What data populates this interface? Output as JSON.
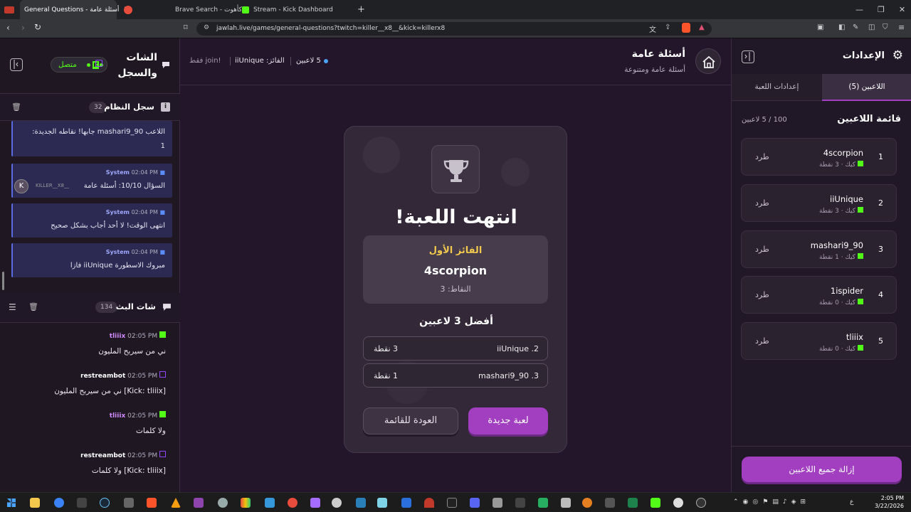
{
  "browser": {
    "tabs": [
      {
        "label": "General Questions - أسئلة عامة",
        "active": true
      },
      {
        "label": "",
        "active": false
      },
      {
        "label": "Brave Search - كأهوت",
        "active": false
      },
      {
        "label": "Stream - Kick Dashboard",
        "active": false
      }
    ],
    "url": "jawlah.live/games/general-questions?twitch=killer__x8__&kick=killerx8"
  },
  "left": {
    "title_line1": "الشات",
    "title_line2": "والسجل",
    "status": "متصل",
    "system_log": {
      "title": "سجل النظام",
      "count": "32",
      "messages": [
        {
          "author": "",
          "time": "",
          "text_line1": "اللاعب mashari9_90 جابها! نقاطه الجديدة:",
          "text_line2": "1"
        },
        {
          "author": "System",
          "time": "02:04 PM",
          "text_line1": "السؤال 10/10: أسئلة عامة",
          "badge": "KILLER__X8__"
        },
        {
          "author": "System",
          "time": "02:04 PM",
          "text_line1": "انتهى الوقت! لا أحد أجاب بشكل صحيح"
        },
        {
          "author": "System",
          "time": "02:04 PM",
          "text_line1": "مبروك الاسطورة iiUnique فازا"
        }
      ]
    },
    "stream_chat": {
      "title": "شات البث",
      "count": "134",
      "messages": [
        {
          "author": "tliiix",
          "time": "02:05 PM",
          "text": "ني من سيربح المليون",
          "platform": "kick"
        },
        {
          "author": "restreambot",
          "time": "02:05 PM",
          "text": "[Kick: tliiix] ني من سيربح المليون",
          "platform": "twitch"
        },
        {
          "author": "tliiix",
          "time": "02:05 PM",
          "text": "ولا كلمات",
          "platform": "kick"
        },
        {
          "author": "restreambot",
          "time": "02:05 PM",
          "text": "[Kick: tliiix] ولا كلمات",
          "platform": "twitch"
        }
      ]
    }
  },
  "header": {
    "title": "أسئلة عامة",
    "subtitle": "أسئلة عامة ومتنوعة",
    "players": "5 لاعبين",
    "winner_label": "الفائز:",
    "winner_name": "iiUnique",
    "join_note": "!join فقط"
  },
  "game_over": {
    "title": "انتهت اللعبة!",
    "first_label": "الفائز الأول",
    "first_name": "4scorpion",
    "first_points": "النقاط: 3",
    "top3_title": "أفضل 3 لاعبين",
    "ranks": [
      {
        "name": "iiUnique .2",
        "points": "3 نقطة"
      },
      {
        "name": "mashari9_90 .3",
        "points": "1 نقطة"
      }
    ],
    "new_game": "لعبة جديدة",
    "back": "العودة للقائمة"
  },
  "right": {
    "title": "الإعدادات",
    "tab_players": "اللاعبين (5)",
    "tab_settings": "إعدادات اللعبة",
    "list_title": "قائمة اللاعبين",
    "list_count": "100 / 5 لاعبين",
    "kick_label": "طرد",
    "players": [
      {
        "rank": "1",
        "name": "4scorpion",
        "meta": "كيك · 3 نقطة"
      },
      {
        "rank": "2",
        "name": "iiUnique",
        "meta": "كيك · 3 نقطة"
      },
      {
        "rank": "3",
        "name": "mashari9_90",
        "meta": "كيك · 1 نقطة"
      },
      {
        "rank": "4",
        "name": "1ispider",
        "meta": "كيك · 0 نقطة"
      },
      {
        "rank": "5",
        "name": "tliiix",
        "meta": "كيك · 0 نقطة"
      }
    ],
    "remove_all": "إزالة جميع اللاعبين"
  },
  "taskbar": {
    "time": "2:05 PM",
    "date": "3/22/2026",
    "lang": "ع"
  },
  "colors": {
    "accent_purple": "#a13fc0",
    "gold": "#f2c94c",
    "kick_green": "#53fc18",
    "twitch_purple": "#9146ff"
  }
}
